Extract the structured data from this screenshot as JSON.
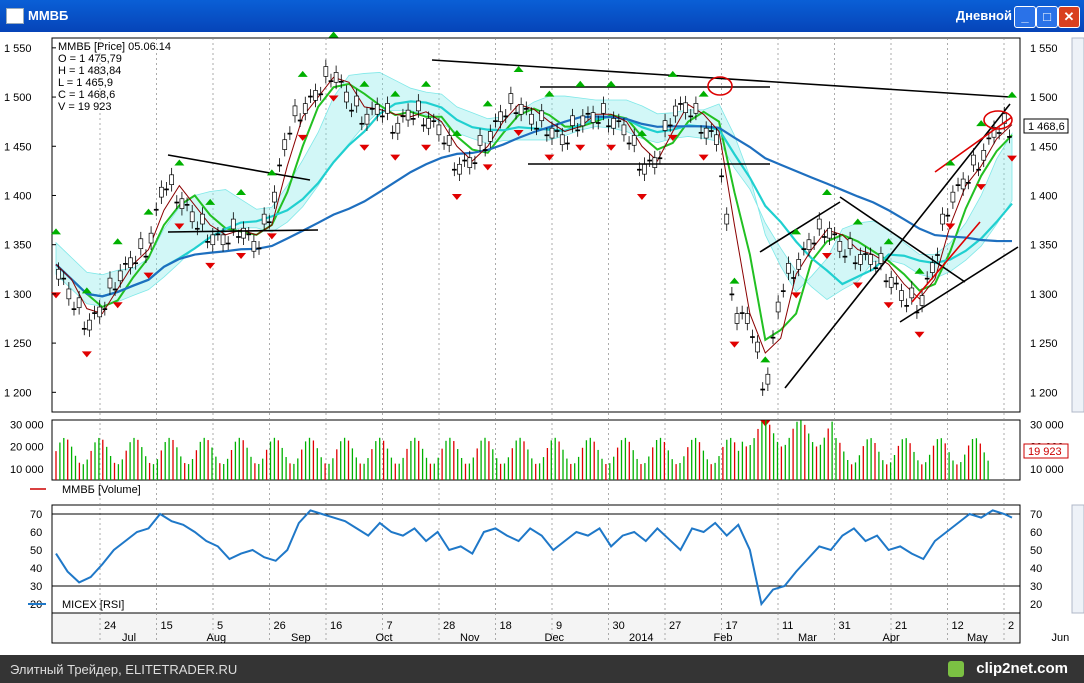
{
  "window": {
    "title": "ММВБ",
    "mode": "Дневной",
    "buttons": {
      "minimize": "_",
      "maximize": "□",
      "close": "✕"
    }
  },
  "info": {
    "header": "ММВБ [Price] 05.06.14",
    "open": "O = 1 475,79",
    "high": "H = 1 483,84",
    "low": "L = 1 465,9",
    "close": "C = 1 468,6",
    "volume": "V = 19 923"
  },
  "current_price_label": "1 468,6",
  "current_volume_label": "19 923",
  "volume_legend": "ММВБ [Volume]",
  "rsi_legend": "MICEX [RSI]",
  "footer": {
    "site": "Элитный Трейдер, ELITETRADER.RU",
    "brand": "clip2net.com"
  },
  "colors": {
    "up": "#00b000",
    "down": "#e00000",
    "cloud": "#7fe8e8",
    "rsi": "#1f78c8",
    "ma_fast": "#22c022",
    "ma_slow": "#1e6fbf",
    "ma_cyan": "#20d0d0"
  },
  "chart_data": [
    {
      "type": "line",
      "name": "price",
      "y_ticks": [
        "1 550",
        "1 500",
        "1 450",
        "1 400",
        "1 350",
        "1 300",
        "1 250",
        "1 200"
      ],
      "ylim": [
        1180,
        1560
      ],
      "x": [
        0,
        4,
        8,
        12,
        16,
        20,
        24,
        28,
        32,
        36,
        40,
        44,
        48,
        52,
        56,
        60,
        64,
        68,
        72,
        76,
        80,
        84,
        88,
        92,
        96,
        100,
        104,
        108,
        112,
        116,
        120,
        124,
        128,
        132,
        136,
        140,
        144,
        148,
        152,
        156,
        160,
        164,
        168,
        172,
        176,
        180,
        184,
        188,
        192,
        196,
        200,
        204,
        208,
        212,
        216,
        220,
        224,
        228,
        232,
        236,
        240,
        244,
        248
      ],
      "y": [
        1330,
        1300,
        1270,
        1290,
        1320,
        1340,
        1350,
        1420,
        1400,
        1380,
        1360,
        1360,
        1370,
        1350,
        1390,
        1470,
        1490,
        1510,
        1530,
        1500,
        1480,
        1495,
        1470,
        1490,
        1480,
        1470,
        1430,
        1440,
        1460,
        1490,
        1495,
        1480,
        1470,
        1460,
        1480,
        1485,
        1480,
        1470,
        1430,
        1440,
        1490,
        1495,
        1470,
        1460,
        1280,
        1280,
        1200,
        1310,
        1330,
        1360,
        1370,
        1350,
        1340,
        1340,
        1320,
        1300,
        1290,
        1340,
        1400,
        1420,
        1440,
        1475,
        1469
      ],
      "x_day_labels": [
        "24",
        "15",
        "5",
        "26",
        "16",
        "7",
        "28",
        "18",
        "9",
        "30",
        "27",
        "17",
        "11",
        "31",
        "21",
        "12",
        "2"
      ],
      "x_month_labels": [
        "Jul",
        "Aug",
        "Sep",
        "Oct",
        "Nov",
        "Dec",
        "2014",
        "Feb",
        "Mar",
        "Apr",
        "May",
        "Jun"
      ]
    },
    {
      "type": "bar",
      "name": "volume",
      "y_ticks": [
        "30 000",
        "20 000",
        "10 000"
      ],
      "ylim": [
        5000,
        32000
      ]
    },
    {
      "type": "line",
      "name": "rsi",
      "y_ticks": [
        "70",
        "60",
        "50",
        "40",
        "30",
        "20"
      ],
      "ylim": [
        15,
        75
      ],
      "x": [
        0,
        3,
        6,
        9,
        12,
        15,
        18,
        21,
        24,
        27,
        30,
        33,
        36,
        39,
        42,
        45,
        48,
        51,
        54,
        57,
        60,
        63,
        66,
        69,
        72,
        75,
        78,
        81,
        84,
        87,
        90,
        93,
        96,
        99,
        102,
        105,
        108,
        111,
        114,
        117,
        120,
        123,
        126,
        129,
        132,
        135,
        138,
        141,
        144,
        147,
        150,
        153,
        156,
        159,
        162,
        165,
        168,
        171,
        174,
        177,
        180,
        183,
        186,
        189,
        192,
        195,
        198,
        201,
        204,
        207,
        210,
        213,
        216,
        219,
        222,
        225,
        228,
        231,
        234,
        237,
        240,
        243,
        246,
        248
      ],
      "y": [
        48,
        38,
        32,
        35,
        42,
        50,
        55,
        60,
        62,
        70,
        66,
        64,
        60,
        55,
        52,
        45,
        48,
        50,
        46,
        44,
        50,
        65,
        72,
        70,
        68,
        66,
        62,
        58,
        65,
        60,
        58,
        62,
        55,
        60,
        50,
        52,
        48,
        60,
        62,
        58,
        55,
        62,
        58,
        50,
        55,
        60,
        58,
        62,
        52,
        58,
        60,
        55,
        62,
        56,
        50,
        62,
        60,
        65,
        58,
        64,
        50,
        20,
        28,
        30,
        38,
        45,
        52,
        50,
        58,
        62,
        55,
        58,
        50,
        52,
        48,
        45,
        55,
        60,
        65,
        70,
        68,
        72,
        70,
        68
      ]
    }
  ]
}
